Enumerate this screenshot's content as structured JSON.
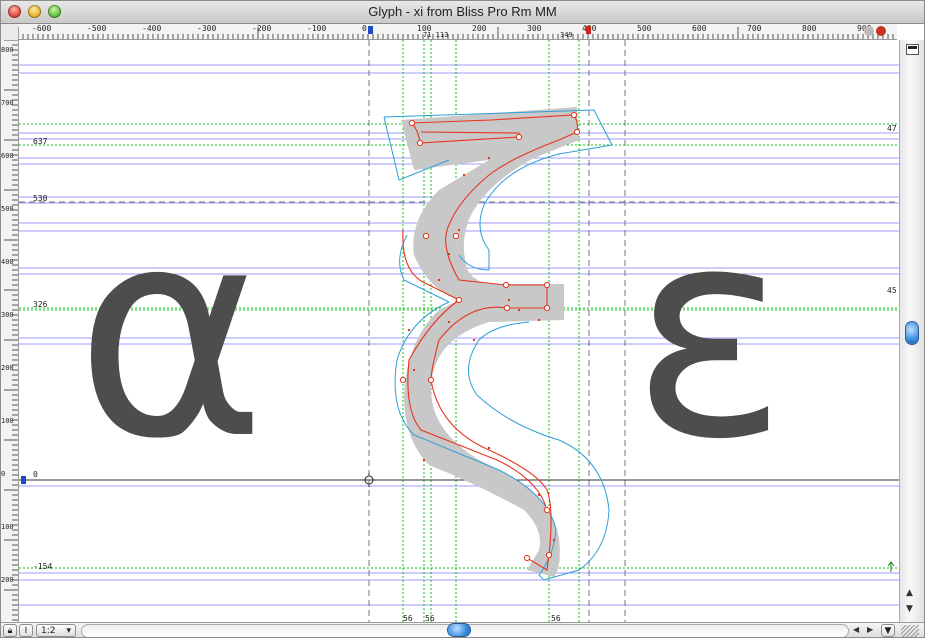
{
  "window": {
    "title": "Glyph - xi from Bliss Pro Rm MM"
  },
  "ruler_top": {
    "labels": [
      "-600",
      "-500",
      "-400",
      "-300",
      "-200",
      "-100",
      "0",
      "100",
      "200",
      "300",
      "400",
      "500",
      "600",
      "700",
      "800",
      "900"
    ]
  },
  "ruler_left": {
    "labels": [
      "800",
      "700",
      "600",
      "500",
      "400",
      "300",
      "200",
      "100",
      "0",
      "100",
      "200",
      "300"
    ]
  },
  "top_markers": {
    "left_pair": "71  113",
    "right": "349"
  },
  "bottom_markers": {
    "a": "56",
    "b": "56",
    "c": "56"
  },
  "metric_labels": {
    "m637": "637",
    "m530": "530",
    "m326": "326",
    "m0": "0",
    "m_neg154": "-154",
    "right_47": "47",
    "right_45": "45"
  },
  "ghost_glyphs": {
    "left": "α",
    "right": "ε"
  },
  "bottom_bar": {
    "zoom": "1:2"
  },
  "colors": {
    "outline": "#e8341c",
    "blue_outline": "#2e9ed8",
    "guide_green": "#00b400",
    "guide_blue": "#4a4aff",
    "glyph_fill": "#c8c8c8",
    "ghost": "#4d4d4d"
  }
}
